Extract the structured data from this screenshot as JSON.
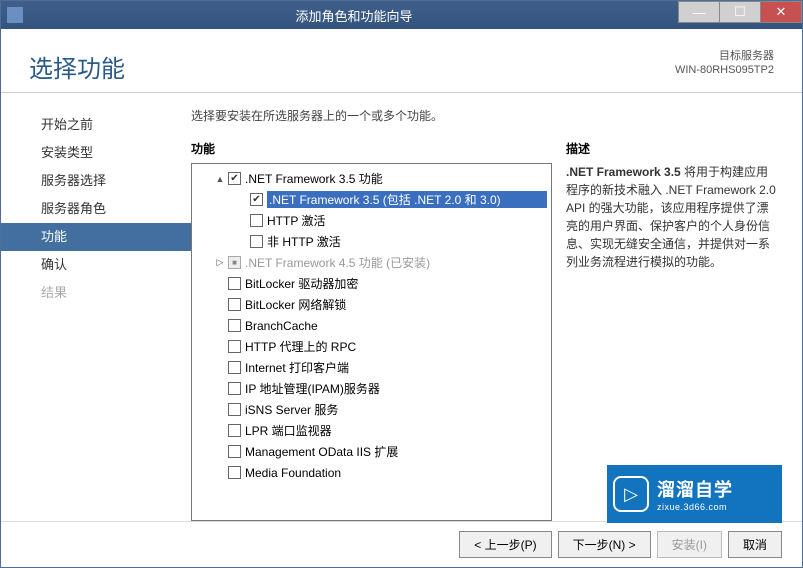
{
  "titlebar": {
    "title": "添加角色和功能向导"
  },
  "header": {
    "page_title": "选择功能",
    "server_label": "目标服务器",
    "server_name": "WIN-80RHS095TP2"
  },
  "sidebar": {
    "items": [
      {
        "label": "开始之前",
        "state": "normal"
      },
      {
        "label": "安装类型",
        "state": "normal"
      },
      {
        "label": "服务器选择",
        "state": "normal"
      },
      {
        "label": "服务器角色",
        "state": "normal"
      },
      {
        "label": "功能",
        "state": "active"
      },
      {
        "label": "确认",
        "state": "normal"
      },
      {
        "label": "结果",
        "state": "disabled"
      }
    ]
  },
  "main": {
    "intro": "选择要安装在所选服务器上的一个或多个功能。",
    "features_header": "功能",
    "desc_header": "描述",
    "features": [
      {
        "indent": 0,
        "expander": "▲",
        "checked": true,
        "selected": false,
        "label": ".NET Framework 3.5 功能"
      },
      {
        "indent": 1,
        "expander": "",
        "checked": true,
        "selected": true,
        "label": ".NET Framework 3.5 (包括 .NET 2.0 和 3.0)"
      },
      {
        "indent": 1,
        "expander": "",
        "checked": false,
        "selected": false,
        "label": "HTTP 激活"
      },
      {
        "indent": 1,
        "expander": "",
        "checked": false,
        "selected": false,
        "label": "非 HTTP 激活"
      },
      {
        "indent": 0,
        "expander": "▷",
        "checked": "partial",
        "selected": false,
        "disabled": true,
        "label": ".NET Framework 4.5 功能 (已安装)"
      },
      {
        "indent": 0,
        "expander": "",
        "checked": false,
        "selected": false,
        "label": "BitLocker 驱动器加密"
      },
      {
        "indent": 0,
        "expander": "",
        "checked": false,
        "selected": false,
        "label": "BitLocker 网络解锁"
      },
      {
        "indent": 0,
        "expander": "",
        "checked": false,
        "selected": false,
        "label": "BranchCache"
      },
      {
        "indent": 0,
        "expander": "",
        "checked": false,
        "selected": false,
        "label": "HTTP 代理上的 RPC"
      },
      {
        "indent": 0,
        "expander": "",
        "checked": false,
        "selected": false,
        "label": "Internet 打印客户端"
      },
      {
        "indent": 0,
        "expander": "",
        "checked": false,
        "selected": false,
        "label": "IP 地址管理(IPAM)服务器"
      },
      {
        "indent": 0,
        "expander": "",
        "checked": false,
        "selected": false,
        "label": "iSNS Server 服务"
      },
      {
        "indent": 0,
        "expander": "",
        "checked": false,
        "selected": false,
        "label": "LPR 端口监视器"
      },
      {
        "indent": 0,
        "expander": "",
        "checked": false,
        "selected": false,
        "label": "Management OData IIS 扩展"
      },
      {
        "indent": 0,
        "expander": "",
        "checked": false,
        "selected": false,
        "label": "Media Foundation"
      }
    ],
    "description": {
      "lead": ".NET Framework 3.5",
      "body": " 将用于构建应用程序的新技术融入 .NET Framework 2.0 API 的强大功能，该应用程序提供了漂亮的用户界面、保护客户的个人身份信息、实现无缝安全通信，并提供对一系列业务流程进行模拟的功能。"
    }
  },
  "footer": {
    "prev": "< 上一步(P)",
    "next": "下一步(N) >",
    "install": "安装(I)",
    "cancel": "取消"
  },
  "watermark": {
    "cn": "溜溜自学",
    "sub": "zixue.3d66.com"
  }
}
